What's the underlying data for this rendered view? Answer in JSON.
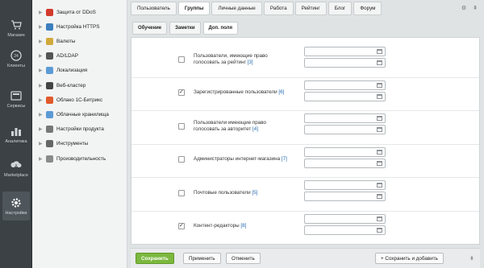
{
  "iconnav": [
    {
      "label": "Магазин",
      "icon": "cart-icon"
    },
    {
      "label": "Клиенты",
      "icon": "crm-icon"
    },
    {
      "label": "Сервисы",
      "icon": "services-icon"
    },
    {
      "label": "Аналитика",
      "icon": "analytics-icon"
    },
    {
      "label": "Marketplace",
      "icon": "cloud-download-icon"
    },
    {
      "label": "Настройки",
      "icon": "gear-icon"
    }
  ],
  "tree": [
    {
      "label": "Защита от DDoS",
      "color": "#d23a2c"
    },
    {
      "label": "Настройка HTTPS",
      "color": "#3c7fbf"
    },
    {
      "label": "Валюты",
      "color": "#d0a93a"
    },
    {
      "label": "AD/LDAP",
      "color": "#555555"
    },
    {
      "label": "Локализация",
      "color": "#5b9bd5"
    },
    {
      "label": "Веб-кластер",
      "color": "#444444"
    },
    {
      "label": "Облако 1С-Битрикс",
      "color": "#e05a2b"
    },
    {
      "label": "Облачные хранилища",
      "color": "#5b9bd5"
    },
    {
      "label": "Настройки продукта",
      "color": "#777777"
    },
    {
      "label": "Инструменты",
      "color": "#666666"
    },
    {
      "label": "Производительность",
      "color": "#8a8a8a"
    }
  ],
  "tabs": [
    "Пользователь",
    "Группы",
    "Личные данные",
    "Работа",
    "Рейтинг",
    "Блог",
    "Форум"
  ],
  "subtabs": [
    "Обучение",
    "Заметки",
    "Доп. поля"
  ],
  "groups": [
    {
      "text": "Пользователи, имеющие право голосовать за рейтинг",
      "count": "[3]",
      "checked": false
    },
    {
      "text": "Зарегистрированные пользователи",
      "count": "[6]",
      "checked": true
    },
    {
      "text": "Пользователи имеющие право голосовать за авторитет",
      "count": "[4]",
      "checked": false
    },
    {
      "text": "Администраторы интернет-магазина",
      "count": "[7]",
      "checked": false
    },
    {
      "text": "Почтовые пользователи",
      "count": "[5]",
      "checked": false
    },
    {
      "text": "Контент-редакторы",
      "count": "[8]",
      "checked": true
    }
  ],
  "buttons": {
    "save": "Сохранить",
    "apply": "Применить",
    "cancel": "Отменить",
    "save_add": "+ Сохранить и добавить"
  },
  "colors": {
    "accent": "#7cb83f",
    "link": "#2067b0"
  }
}
